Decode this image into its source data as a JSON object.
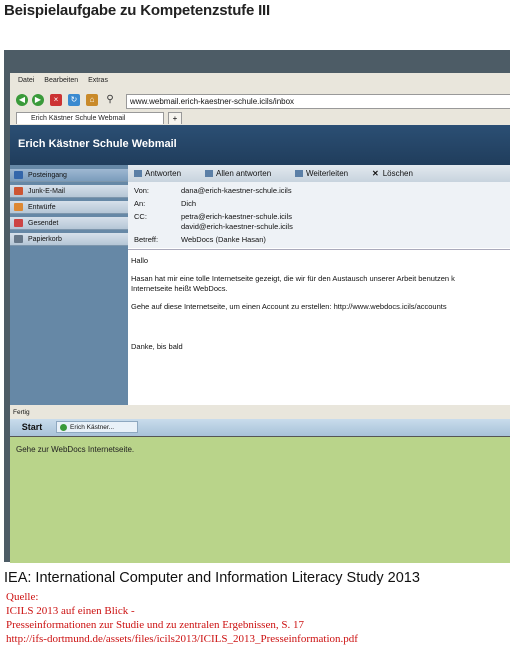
{
  "heading": "Beispielaufgabe zu Kompetenzstufe III",
  "browser": {
    "menu": [
      "Datei",
      "Bearbeiten",
      "Extras"
    ],
    "url": "www.webmail.erich-kaestner-schule.icils/inbox",
    "tab_title": "Erich Kästner Schule Webmail",
    "new_tab": "+"
  },
  "app": {
    "title": "Erich Kästner Schule Webmail",
    "folders": [
      {
        "label": "Posteingang",
        "icon": "inbox-icon"
      },
      {
        "label": "Junk-E-Mail",
        "icon": "junk-mail-icon"
      },
      {
        "label": "Entwürfe",
        "icon": "drafts-icon"
      },
      {
        "label": "Gesendet",
        "icon": "sent-icon"
      },
      {
        "label": "Papierkorb",
        "icon": "trash-icon"
      }
    ],
    "toolbar": {
      "reply": "Antworten",
      "reply_all": "Allen antworten",
      "forward": "Weiterleiten",
      "delete": "Löschen"
    },
    "mail": {
      "from_label": "Von:",
      "from": "dana@erich-kaestner-schule.icils",
      "to_label": "An:",
      "to": "Dich",
      "cc_label": "CC:",
      "cc1": "petra@erich-kaestner-schule.icils",
      "cc2": "david@erich-kaestner-schule.icils",
      "subject_label": "Betreff:",
      "subject": "WebDocs (Danke Hasan)",
      "body": {
        "greeting": "Hallo",
        "line1": "Hasan hat mir eine tolle Internetseite gezeigt, die wir für den Austausch unserer Arbeit benutzen k",
        "line2": "Internetseite heißt WebDocs.",
        "line3": "Gehe auf diese Internetseite, um einen Account zu erstellen: http://www.webdocs.icils/accounts",
        "closing": "Danke, bis bald"
      }
    }
  },
  "status_text": "Fertig",
  "taskbar": {
    "start": "Start",
    "task": "Erich Kästner..."
  },
  "task_instruction": "Gehe zur WebDocs Internetseite.",
  "caption": "IEA: International Computer and Information Literacy Study 2013",
  "source": {
    "label": "Quelle:",
    "line1": "ICILS 2013 auf einen Blick -",
    "line2": "Presseinformationen zur Studie und zu zentralen Ergebnissen, S. 17",
    "line3": "http://ifs-dortmund.de/assets/files/icils2013/ICILS_2013_Presseinformation.pdf"
  }
}
